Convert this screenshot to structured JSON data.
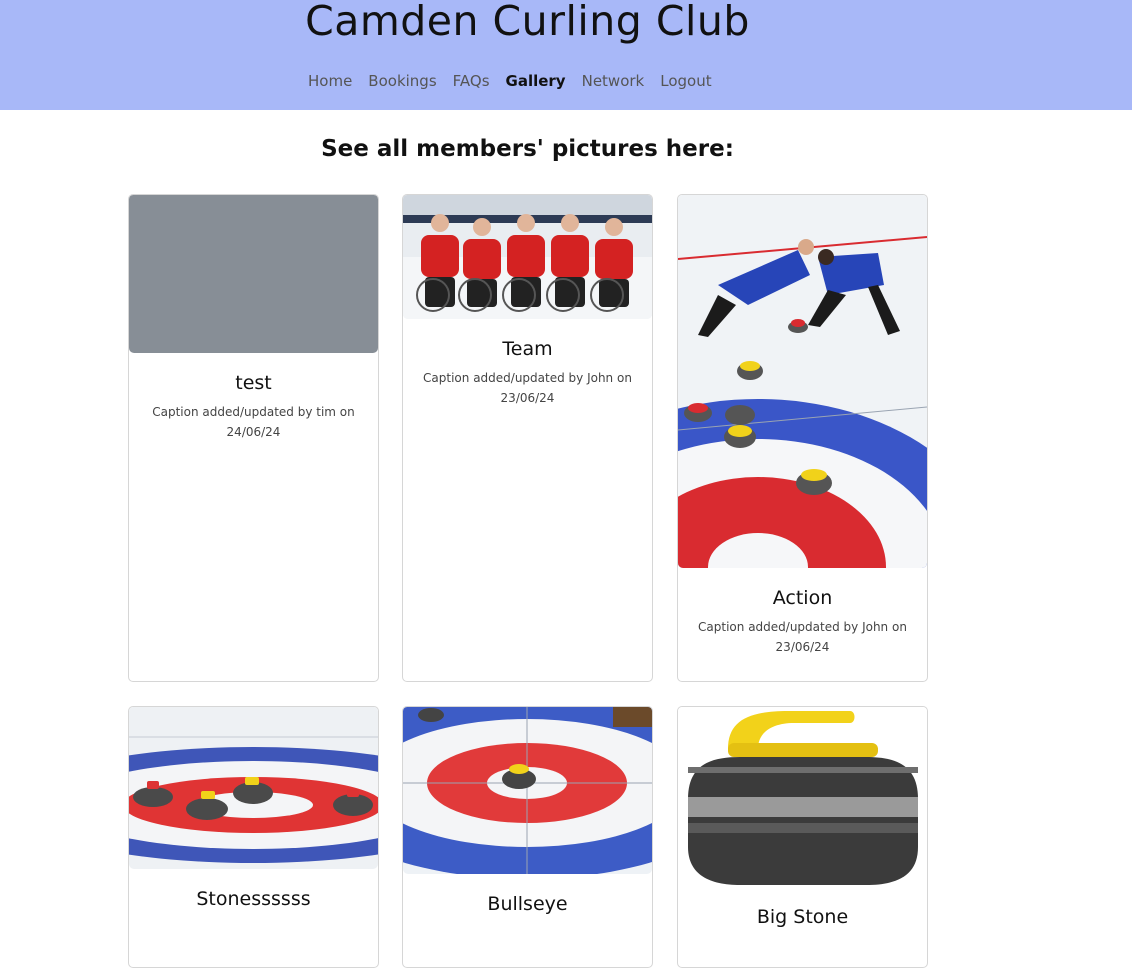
{
  "header": {
    "title": "Camden Curling Club",
    "nav": [
      "Home",
      "Bookings",
      "FAQs",
      "Gallery",
      "Network",
      "Logout"
    ],
    "active": "Gallery"
  },
  "gallery": {
    "heading": "See all members' pictures here:",
    "cards": [
      {
        "title": "test",
        "caption": "Caption added/updated by tim on 24/06/24"
      },
      {
        "title": "Team",
        "caption": "Caption added/updated by John on 23/06/24"
      },
      {
        "title": "Action",
        "caption": "Caption added/updated by John on 23/06/24"
      },
      {
        "title": "Stonessssss",
        "caption": ""
      },
      {
        "title": "Bullseye",
        "caption": ""
      },
      {
        "title": "Big Stone",
        "caption": ""
      }
    ]
  },
  "colors": {
    "header_bg": "#a8b8f8",
    "placeholder_gray": "#878e96"
  }
}
